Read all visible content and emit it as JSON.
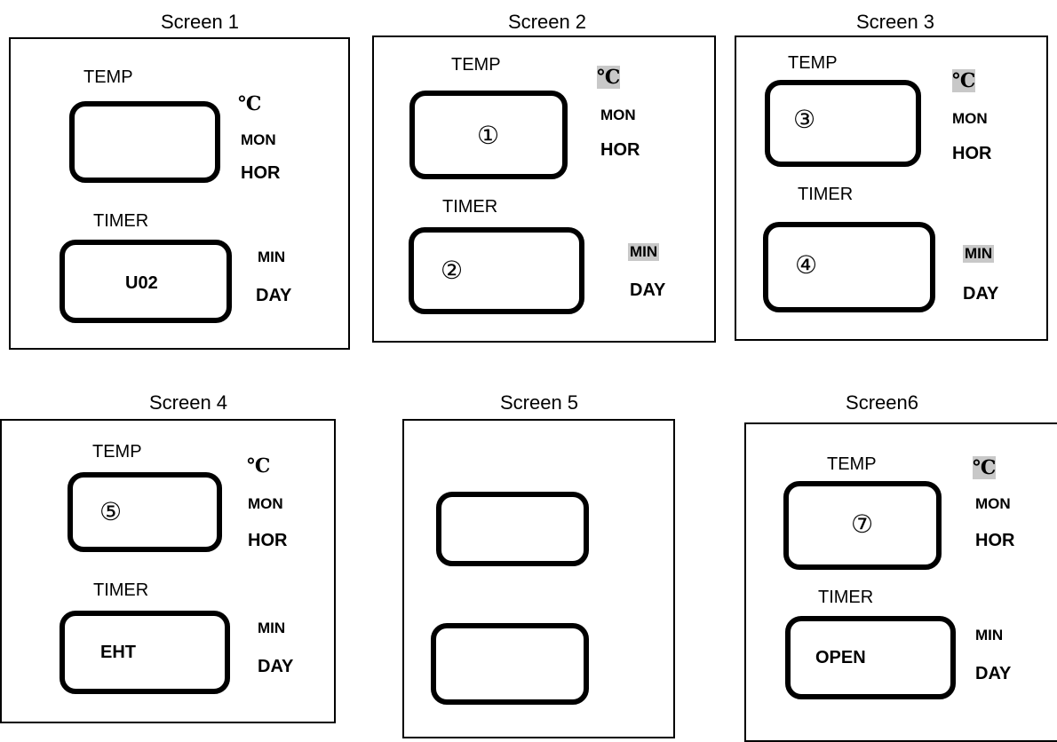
{
  "screens": [
    {
      "title": "Screen 1",
      "temp_label": "TEMP",
      "timer_label": "TIMER",
      "temp_value": "",
      "timer_value": "U02",
      "units": {
        "celsius": "℃",
        "mon": "MON",
        "hor": "HOR",
        "min": "MIN",
        "day": "DAY"
      },
      "highlighted_units": []
    },
    {
      "title": "Screen 2",
      "temp_label": "TEMP",
      "timer_label": "TIMER",
      "temp_value": "①",
      "timer_value": "②",
      "units": {
        "celsius": "℃",
        "mon": "MON",
        "hor": "HOR",
        "min": "MIN",
        "day": "DAY"
      },
      "highlighted_units": [
        "celsius",
        "min"
      ]
    },
    {
      "title": "Screen 3",
      "temp_label": "TEMP",
      "timer_label": "TIMER",
      "temp_value": "③",
      "timer_value": "④",
      "units": {
        "celsius": "℃",
        "mon": "MON",
        "hor": "HOR",
        "min": "MIN",
        "day": "DAY"
      },
      "highlighted_units": [
        "celsius",
        "min"
      ]
    },
    {
      "title": "Screen 4",
      "temp_label": "TEMP",
      "timer_label": "TIMER",
      "temp_value": "⑤",
      "timer_value": "EHT",
      "units": {
        "celsius": "℃",
        "mon": "MON",
        "hor": "HOR",
        "min": "MIN",
        "day": "DAY"
      },
      "highlighted_units": []
    },
    {
      "title": "Screen 5",
      "temp_value": "",
      "timer_value": ""
    },
    {
      "title": "Screen6",
      "temp_label": "TEMP",
      "timer_label": "TIMER",
      "temp_value": "⑦",
      "timer_value": "OPEN",
      "units": {
        "celsius": "℃",
        "mon": "MON",
        "hor": "HOR",
        "min": "MIN",
        "day": "DAY"
      },
      "highlighted_units": [
        "celsius"
      ]
    }
  ],
  "colors": {
    "highlight": "#c8c8c8",
    "border": "#000000"
  }
}
